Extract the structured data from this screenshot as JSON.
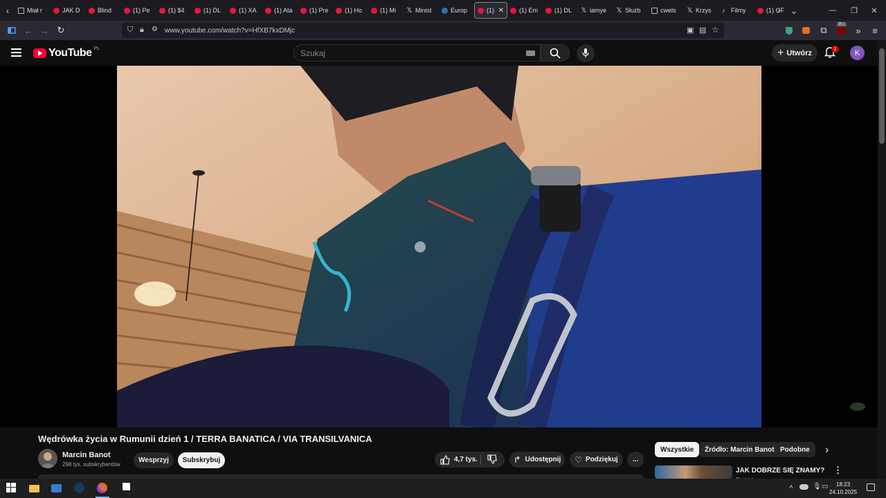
{
  "browser": {
    "tabs": [
      {
        "label": "Miał r",
        "icon": "generic"
      },
      {
        "label": "JAK D",
        "icon": "youtube"
      },
      {
        "label": "Blind",
        "icon": "youtube"
      },
      {
        "label": "(1) Pe",
        "icon": "youtube"
      },
      {
        "label": "(1) $4",
        "icon": "youtube"
      },
      {
        "label": "(1) DL",
        "icon": "youtube"
      },
      {
        "label": "(1) XA",
        "icon": "youtube"
      },
      {
        "label": "(1) Ata",
        "icon": "youtube"
      },
      {
        "label": "(1) Pre",
        "icon": "youtube"
      },
      {
        "label": "(1) Ho",
        "icon": "youtube"
      },
      {
        "label": "(1) Mi",
        "icon": "youtube"
      },
      {
        "label": "Minist",
        "icon": "x"
      },
      {
        "label": "Europ",
        "icon": "globe"
      },
      {
        "label": "(1)",
        "icon": "youtube",
        "active": true
      },
      {
        "label": "(1) Em",
        "icon": "youtube"
      },
      {
        "label": "(1) DL",
        "icon": "youtube"
      },
      {
        "label": "iamye",
        "icon": "x"
      },
      {
        "label": "Służb",
        "icon": "x"
      },
      {
        "label": "cwels",
        "icon": "calendar"
      },
      {
        "label": "Krzys",
        "icon": "x"
      },
      {
        "label": "Filmy",
        "icon": "tiktok"
      },
      {
        "label": "(1) OF",
        "icon": "youtube"
      }
    ],
    "url": "www.youtube.com/watch?v=HfXB7kxDMjc",
    "extension_badge": "351"
  },
  "youtube": {
    "logo_text": "YouTube",
    "country_code": "PL",
    "search_placeholder": "Szukaj",
    "create_label": "Utwórz",
    "notification_count": "1",
    "avatar_letter": "K"
  },
  "video": {
    "title": "Wędrówka życia w Rumunii dzień 1 / TERRA BANATICA / VIA TRANSILVANICA",
    "channel_name": "Marcin Banot",
    "subscribers": "298 tys. subskrybentów",
    "support_label": "Wesprzyj",
    "subscribe_label": "Subskrybuj",
    "likes": "4,7 tys.",
    "share_label": "Udostępnij",
    "thanks_label": "Podziękuj",
    "more_label": "..."
  },
  "sidebar": {
    "chips": [
      "Wszystkie",
      "Źródło: Marcin Banot",
      "Podobne"
    ],
    "recommendation": {
      "title": "JAK DOBRZE SIĘ ZNAMY?",
      "channel": "Bugree"
    }
  },
  "taskbar": {
    "time": "18:23",
    "date": "24.10.2025"
  },
  "colors": {
    "youtube_red": "#ff0033",
    "background": "#0f0f0f",
    "avatar": "#7e57c2"
  }
}
